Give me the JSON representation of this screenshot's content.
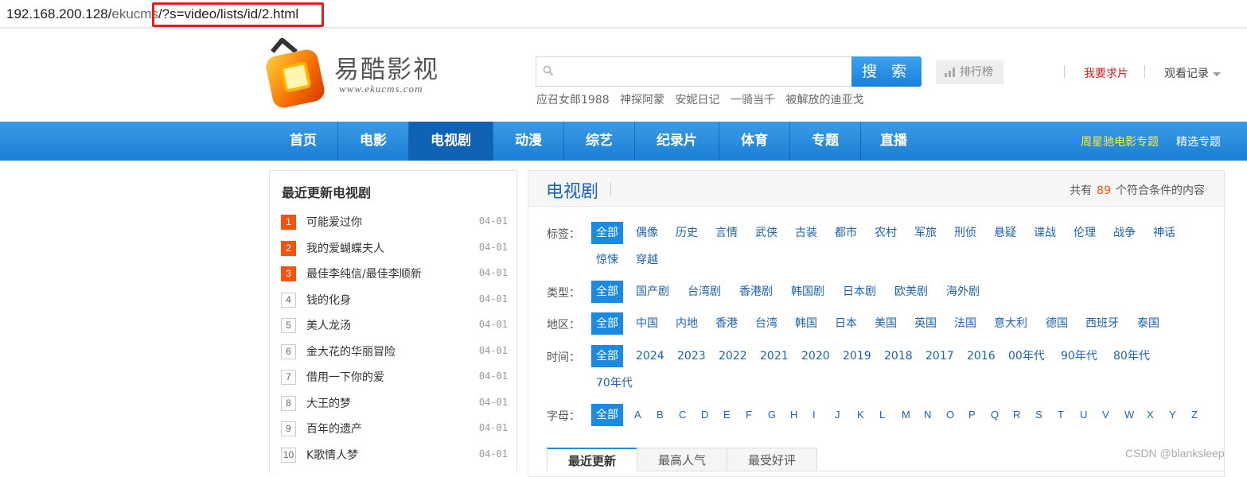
{
  "browser": {
    "url_host": "192.168.200.128/",
    "url_dir": "ekucms",
    "url_rest": "/?s=video/lists/id/2.html"
  },
  "header": {
    "logo_text": "易酷影视",
    "logo_sub": "www.ekucms.com",
    "search_placeholder": "",
    "search_button": "搜 索",
    "rank_button": "排行榜",
    "hot_words": [
      "应召女郎1988",
      "神探阿蒙",
      "安妮日记",
      "一骑当千",
      "被解放的迪亚戈"
    ],
    "request_link": "我要求片",
    "history_link": "观看记录"
  },
  "nav": {
    "items": [
      "首页",
      "电影",
      "电视剧",
      "动漫",
      "综艺",
      "纪录片",
      "体育",
      "专题",
      "直播"
    ],
    "active": "电视剧",
    "right_special": "周星驰电影专题",
    "right_topics": "精选专题"
  },
  "sidebar": {
    "title": "最近更新电视剧",
    "items": [
      {
        "rank": "1",
        "name": "可能爱过你",
        "date": "04-01"
      },
      {
        "rank": "2",
        "name": "我的爱蝴蝶夫人",
        "date": "04-01"
      },
      {
        "rank": "3",
        "name": "最佳李纯信/最佳李顺新",
        "date": "04-01"
      },
      {
        "rank": "4",
        "name": "钱的化身",
        "date": "04-01"
      },
      {
        "rank": "5",
        "name": "美人龙汤",
        "date": "04-01"
      },
      {
        "rank": "6",
        "name": "金大花的华丽冒险",
        "date": "04-01"
      },
      {
        "rank": "7",
        "name": "借用一下你的爱",
        "date": "04-01"
      },
      {
        "rank": "8",
        "name": "大王的梦",
        "date": "04-01"
      },
      {
        "rank": "9",
        "name": "百年的遗产",
        "date": "04-01"
      },
      {
        "rank": "10",
        "name": "K歌情人梦",
        "date": "04-01"
      }
    ]
  },
  "main": {
    "title": "电视剧",
    "count_prefix": "共有",
    "count": "89",
    "count_suffix": "个符合条件的内容",
    "filters": {
      "tag": {
        "label": "标签：",
        "all": "全部",
        "options": [
          "偶像",
          "历史",
          "言情",
          "武侠",
          "古装",
          "都市",
          "农村",
          "军旅",
          "刑侦",
          "悬疑",
          "谍战",
          "伦理",
          "战争",
          "神话",
          "惊悚",
          "穿越"
        ]
      },
      "type": {
        "label": "类型：",
        "all": "全部",
        "options": [
          "国产剧",
          "台湾剧",
          "香港剧",
          "韩国剧",
          "日本剧",
          "欧美剧",
          "海外剧"
        ]
      },
      "region": {
        "label": "地区：",
        "all": "全部",
        "options": [
          "中国",
          "内地",
          "香港",
          "台湾",
          "韩国",
          "日本",
          "美国",
          "英国",
          "法国",
          "意大利",
          "德国",
          "西班牙",
          "泰国"
        ]
      },
      "time": {
        "label": "时间：",
        "all": "全部",
        "options": [
          "2024",
          "2023",
          "2022",
          "2021",
          "2020",
          "2019",
          "2018",
          "2017",
          "2016",
          "00年代",
          "90年代",
          "80年代",
          "70年代"
        ]
      },
      "letter": {
        "label": "字母：",
        "all": "全部",
        "options": [
          "A",
          "B",
          "C",
          "D",
          "E",
          "F",
          "G",
          "H",
          "I",
          "J",
          "K",
          "L",
          "M",
          "N",
          "O",
          "P",
          "Q",
          "R",
          "S",
          "T",
          "U",
          "V",
          "W",
          "X",
          "Y",
          "Z"
        ]
      }
    },
    "tabs": [
      "最近更新",
      "最高人气",
      "最受好评"
    ]
  },
  "watermark": "CSDN @blanksleep",
  "colors": {
    "accent": "#1b8ae0",
    "nav": "#1b7fd4",
    "rank_top": "#f5530e",
    "link": "#1d63ac",
    "url_highlight": "#e02020"
  }
}
